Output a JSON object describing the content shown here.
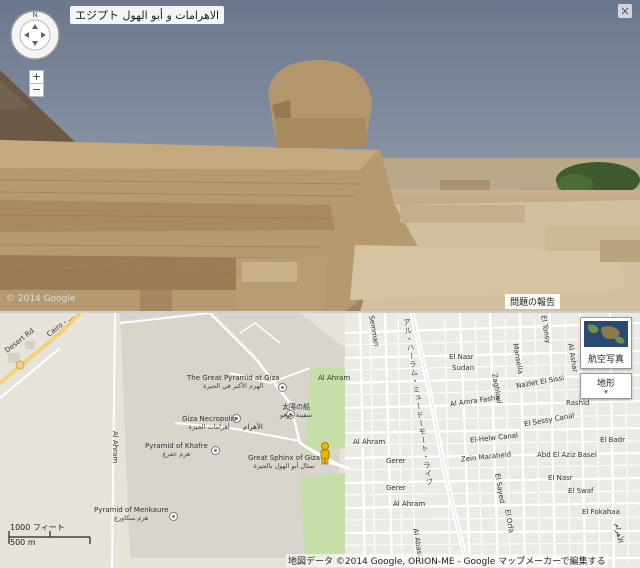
{
  "streetview": {
    "title": "エジプト الاهرامات و أبو الهول",
    "compass_north": "N",
    "zoom_in": "+",
    "zoom_out": "−",
    "close": "×",
    "copyright": "© 2014 Google",
    "report_button": "問題の報告"
  },
  "map": {
    "places": [
      {
        "id": "pyramid-giza",
        "en": "The Great Pyramid at Giza",
        "ar": "الهرم الأكبر في الجيزة"
      },
      {
        "id": "necropolis",
        "en": "Giza Necropolis",
        "ar": "أهرامات الجيزة"
      },
      {
        "id": "khafre",
        "en": "Pyramid of Khafre",
        "ar": "هرم خفرع"
      },
      {
        "id": "sphinx",
        "en": "Great Sphinx of Giza",
        "ar": "تمثال أبو الهول بالجيزة"
      },
      {
        "id": "menkaure",
        "en": "Pyramid of Menkaure",
        "ar": "هرم منكاورع"
      },
      {
        "id": "solar-boat",
        "en": "太陽の船",
        "ar": "سفينة خوفو"
      }
    ],
    "arabic_al_ahram": "الأهرام",
    "streets": {
      "desert_rd": "Desert Rd",
      "cairo": "Cairo - ...",
      "al_ahram_1": "Al Ahram",
      "al_ahram_2": "Al Ahram",
      "al_ahram_3": "Al Ahram",
      "al_ahram_4": "Al Ahram",
      "el_nasr": "El Nasr",
      "sudan": "Sudan",
      "al_amra_fasha": "Al Amra Fasha",
      "el_helw_canal": "El-Helw Canal",
      "zein_maraheid": "Zein Maraheid",
      "abd_el_aziz_basel": "Abd El Aziz Basel",
      "nazlet_el_sissi": "Nazlet El Sissi",
      "el_sessy_canal": "El Sessy Canal",
      "rashid": "Rashid",
      "el_fokahaa": "El Fokahaa",
      "gerer_1": "Gerer",
      "gerer_2": "Gerer",
      "semman": "Semman",
      "mansella": "Mansella",
      "el_tonsy": "El Tonsy",
      "el_sayed": "El Sayed",
      "zaghloul": "Zaghloul",
      "el_orfa": "El Orfa",
      "al_abasi": "Al Abasi",
      "al_ashar": "Al Ashar",
      "el_badr": "El Badr",
      "el_nasr_2": "El Nasr",
      "el_swaf": "El Swaf",
      "arabic_road": "الأهرام",
      "main_road": "アル・ハーラム・ミュードーモート・ライブ"
    },
    "satellite_label": "航空写真",
    "terrain_label": "地形",
    "terrain_caret": "▾",
    "scale_ft": "1000 フィート",
    "scale_m": "500 m",
    "attribution": "地図データ ©2014 Google, ORION-ME - Google マップメーカーで編集する"
  },
  "colors": {
    "sky": "#7d8aa0",
    "sand": "#bba27c",
    "stone": "#b29468",
    "map_bg": "#eae6df",
    "park": "#c6dfa9",
    "road": "#fefefe"
  }
}
